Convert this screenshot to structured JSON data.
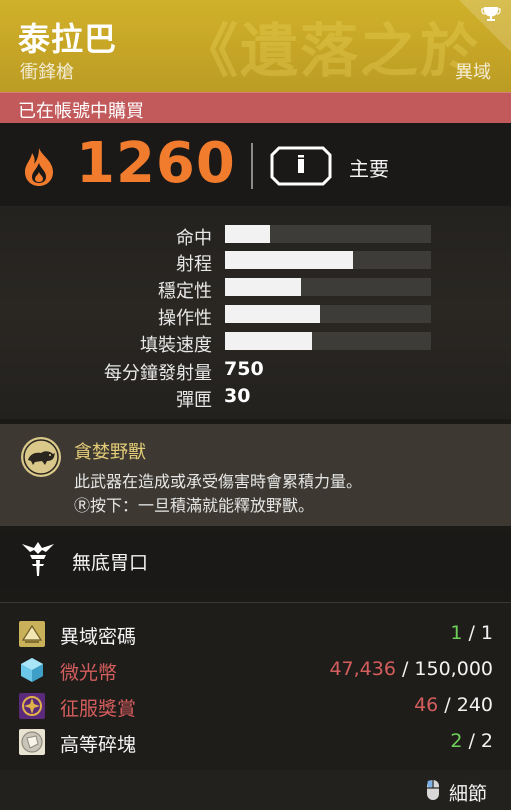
{
  "header": {
    "title": "泰拉巴",
    "subtitle": "衝鋒槍",
    "rarity": "異域",
    "watermark": "《遺落之於"
  },
  "owned_status": "已在帳號中購買",
  "power": {
    "value": "1260",
    "ammo_type": "主要"
  },
  "stats": [
    {
      "label": "命中",
      "fill": 0.22
    },
    {
      "label": "射程",
      "fill": 0.62
    },
    {
      "label": "穩定性",
      "fill": 0.37
    },
    {
      "label": "操作性",
      "fill": 0.46
    },
    {
      "label": "填裝速度",
      "fill": 0.42
    }
  ],
  "numeric_stats": [
    {
      "label": "每分鐘發射量",
      "value": "750"
    },
    {
      "label": "彈匣",
      "value": "30"
    }
  ],
  "perks": {
    "intrinsic": {
      "name": "貪婪野獸",
      "desc_line1": "此武器在造成或承受傷害時會累積力量。",
      "desc_line2": "Ⓡ按下：一旦積滿就能釋放野獸。"
    },
    "catalyst": {
      "name": "無底胃口"
    }
  },
  "costs": [
    {
      "name": "異域密碼",
      "current": "1",
      "total": "1",
      "name_color": "#f2f2f2",
      "current_color": "#6fcf5b"
    },
    {
      "name": "微光幣",
      "current": "47,436",
      "total": "150,000",
      "name_color": "#d45d5d",
      "current_color": "#d45d5d"
    },
    {
      "name": "征服獎賞",
      "current": "46",
      "total": "240",
      "name_color": "#d45d5d",
      "current_color": "#d45d5d"
    },
    {
      "name": "高等碎塊",
      "current": "2",
      "total": "2",
      "name_color": "#f2f2f2",
      "current_color": "#6fcf5b"
    }
  ],
  "footer": {
    "details_label": "細節"
  },
  "colors": {
    "header_gold": "#c6a526",
    "owned_red": "#c25a5b",
    "power_orange": "#f17c2e",
    "perk_gold": "#e2cb77"
  },
  "icons": [
    "trophy-icon",
    "flame-icon",
    "primary-ammo-icon",
    "beast-perk-icon",
    "catalyst-icon",
    "exotic-cipher-icon",
    "glimmer-icon",
    "conqueror-reward-icon",
    "enhancement-shard-icon",
    "mouse-icon"
  ]
}
